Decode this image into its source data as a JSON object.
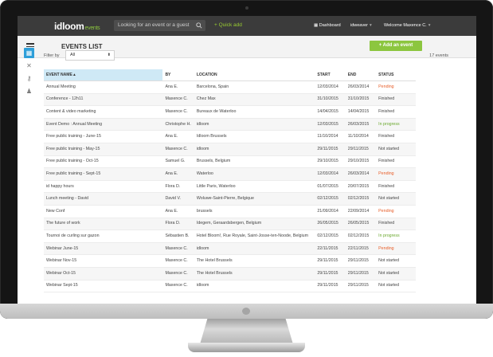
{
  "app": {
    "logo_main": "idloom",
    "logo_sub": "events",
    "search_placeholder": "Looking for an event or a guest",
    "quick_add": "Quick add",
    "dashboard": "Dashboard",
    "account": "idweaver",
    "welcome": "Welcome Maxence C."
  },
  "page": {
    "title": "EVENTS LIST",
    "add_button": "+ Add an event",
    "filter_label": "Filter by",
    "filter_value": "All",
    "count": "17 events"
  },
  "columns": [
    "EVENT NAME ▴",
    "BY",
    "LOCATION",
    "START",
    "END",
    "STATUS"
  ],
  "rows": [
    {
      "name": "Annual Meeting",
      "by": "Ana E.",
      "location": "Barcelona, Spain",
      "start": "12/03/2014",
      "end": "26/03/2014",
      "status": "Pending",
      "cls": "st-pending"
    },
    {
      "name": "Conference - 12h11",
      "by": "Maxence C.",
      "location": "Chez Max",
      "start": "31/10/2015",
      "end": "31/10/2015",
      "status": "Finished",
      "cls": "st-finished"
    },
    {
      "name": "Content & video marketing",
      "by": "Maxence C.",
      "location": "Bureaux de Waterloo",
      "start": "14/04/2015",
      "end": "14/04/2015",
      "status": "Finished",
      "cls": "st-finished"
    },
    {
      "name": "Event Demo : Annual Meeting",
      "by": "Christophe H.",
      "location": "idloom",
      "start": "12/03/2015",
      "end": "26/03/2015",
      "status": "In progress",
      "cls": "st-progress"
    },
    {
      "name": "Free public training - June-15",
      "by": "Ana E.",
      "location": "Idloom Brussels",
      "start": "11/10/2014",
      "end": "11/10/2014",
      "status": "Finished",
      "cls": "st-finished"
    },
    {
      "name": "Free public training - May-15",
      "by": "Maxence C.",
      "location": "idloom",
      "start": "29/11/2015",
      "end": "29/11/2015",
      "status": "Not started",
      "cls": "st-notstarted"
    },
    {
      "name": "Free public training - Oct-15",
      "by": "Samuel G.",
      "location": "Brussels, Belgium",
      "start": "29/10/2015",
      "end": "29/10/2015",
      "status": "Finished",
      "cls": "st-finished"
    },
    {
      "name": "Free public training - Sept-15",
      "by": "Ana E.",
      "location": "Waterloo",
      "start": "12/03/2014",
      "end": "26/03/2014",
      "status": "Pending",
      "cls": "st-pending"
    },
    {
      "name": "id happy hours",
      "by": "Flora D.",
      "location": "Little Paris, Waterloo",
      "start": "01/07/2015",
      "end": "20/07/2015",
      "status": "Finished",
      "cls": "st-finished"
    },
    {
      "name": "Lunch meeting - David",
      "by": "David V.",
      "location": "Woluwe-Saint-Pierre, Belgique",
      "start": "02/12/2015",
      "end": "02/12/2015",
      "status": "Not started",
      "cls": "st-notstarted"
    },
    {
      "name": "New Conf",
      "by": "Ana E.",
      "location": "brussels",
      "start": "21/09/2014",
      "end": "22/09/2014",
      "status": "Pending",
      "cls": "st-pending"
    },
    {
      "name": "The future of work",
      "by": "Flora D.",
      "location": "Idegem, Geraardsbergen, Belgium",
      "start": "26/05/2015",
      "end": "26/05/2015",
      "status": "Finished",
      "cls": "st-finished"
    },
    {
      "name": "Tournoi de curling sur gazon",
      "by": "Sébastien B.",
      "location": "Hotel Bloom!, Rue Royale, Saint-Josse-ten-Noode, Belgium",
      "start": "02/12/2015",
      "end": "02/12/2015",
      "status": "In progress",
      "cls": "st-progress"
    },
    {
      "name": "Webinar June-15",
      "by": "Maxence C.",
      "location": "idloom",
      "start": "22/11/2015",
      "end": "22/11/2015",
      "status": "Pending",
      "cls": "st-pending"
    },
    {
      "name": "Webinar Nov-15",
      "by": "Maxence C.",
      "location": "The Hotel Brussels",
      "start": "29/11/2015",
      "end": "29/11/2015",
      "status": "Not started",
      "cls": "st-notstarted"
    },
    {
      "name": "Webinar Oct-15",
      "by": "Maxence C.",
      "location": "The Hotel Brussels",
      "start": "29/11/2015",
      "end": "29/11/2015",
      "status": "Not started",
      "cls": "st-notstarted"
    },
    {
      "name": "Webinar Sept-15",
      "by": "Maxence C.",
      "location": "idloom",
      "start": "29/11/2015",
      "end": "29/11/2015",
      "status": "Not started",
      "cls": "st-notstarted"
    }
  ]
}
